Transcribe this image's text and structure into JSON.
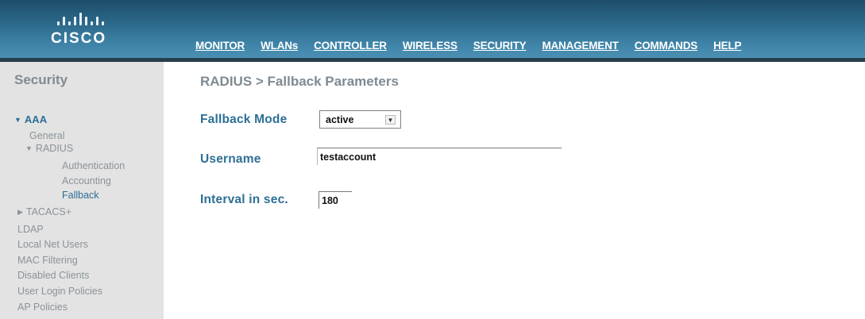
{
  "brand": {
    "logo_text": "CISCO"
  },
  "nav": {
    "items": [
      {
        "label": "MONITOR"
      },
      {
        "label": "WLANs"
      },
      {
        "label": "CONTROLLER"
      },
      {
        "label": "WIRELESS"
      },
      {
        "label": "SECURITY"
      },
      {
        "label": "MANAGEMENT"
      },
      {
        "label": "COMMANDS"
      },
      {
        "label": "HELP"
      }
    ],
    "active": "SECURITY",
    "active_color": "#e39a2e"
  },
  "sidebar": {
    "title": "Security",
    "aaa": "AAA",
    "general": "General",
    "radius": "RADIUS",
    "authentication": "Authentication",
    "accounting": "Accounting",
    "fallback": "Fallback",
    "tacacs": "TACACS+",
    "ldap": "LDAP",
    "local_net_users": "Local Net Users",
    "mac_filtering": "MAC Filtering",
    "disabled_clients": "Disabled Clients",
    "user_login_policies": "User Login Policies",
    "ap_policies": "AP Policies"
  },
  "main": {
    "title": "RADIUS > Fallback Parameters",
    "fallback_mode_label": "Fallback Mode",
    "fallback_mode_value": "active",
    "username_label": "Username",
    "username_value": "testaccount",
    "interval_label": "Interval in sec.",
    "interval_value": "180"
  },
  "colors": {
    "header": "#2d6a8c",
    "label_blue": "#2d6f95",
    "sidebar_bg": "#e3e3e3"
  }
}
